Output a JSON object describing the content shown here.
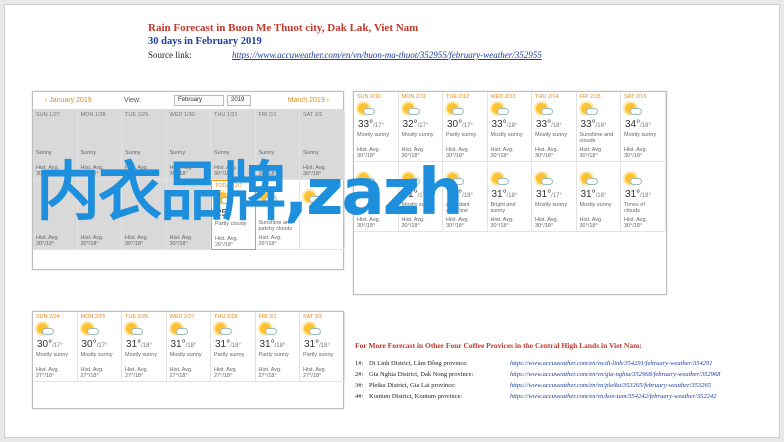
{
  "header": {
    "title": "Rain Forecast in Buon Me Thuot city, Dak Lak, Viet Nam",
    "subtitle": "30 days in February 2019",
    "source_label": "Source link:",
    "source_url": "https://www.accuweather.com/en/vn/buon-ma-thuot/352955/february-weather/352955"
  },
  "calendar": {
    "prev": "‹ January 2019",
    "view_label": "View:",
    "month_select": "February",
    "year_select": "2019",
    "next": "March 2019 ›"
  },
  "panel1": [
    {
      "day": "SUN 1/27",
      "hi": "",
      "desc": "Sunny",
      "avg": "Hist. Avg. 30°/18°",
      "past": true
    },
    {
      "day": "MON 1/28",
      "hi": "",
      "desc": "Sunny",
      "avg": "Hist. Avg. 30°/18°",
      "past": true
    },
    {
      "day": "TUE 1/29",
      "hi": "",
      "desc": "Sunny",
      "avg": "Hist. Avg. 30°/18°",
      "past": true
    },
    {
      "day": "WED 1/30",
      "hi": "",
      "desc": "Sunny",
      "avg": "Hist. Avg. 30°/18°",
      "past": true
    },
    {
      "day": "THU 1/31",
      "hi": "",
      "desc": "Sunny",
      "avg": "Hist. Avg. 30°/18°",
      "past": true
    },
    {
      "day": "FRI 2/1",
      "hi": "",
      "desc": "Sunny",
      "avg": "Hist. Avg. 30°/18°",
      "past": true
    },
    {
      "day": "SAT 2/2",
      "hi": "",
      "desc": "Sunny",
      "avg": "Hist. Avg. 30°/18°",
      "past": true
    },
    {
      "day": "",
      "hi": "",
      "desc": "",
      "avg": "Hist. Avg. 30°/18°",
      "past": true
    },
    {
      "day": "",
      "hi": "",
      "desc": "",
      "avg": "Hist. Avg. 30°/18°",
      "past": true
    },
    {
      "day": "",
      "hi": "",
      "desc": "",
      "avg": "Hist. Avg. 30°/18°",
      "past": true
    },
    {
      "day": "",
      "hi": "",
      "desc": "",
      "avg": "Hist. Avg. 30°/18°",
      "past": true
    },
    {
      "day": "TODAY 2/7",
      "hi": "25°",
      "desc": "Partly cloudy",
      "avg": "Hist. Avg. 26°/18°",
      "past": false,
      "today": true
    },
    {
      "day": "",
      "hi": "",
      "desc": "Sunshine and patchy clouds",
      "avg": "Hist. Avg. 26°/18°",
      "past": false
    },
    {
      "day": "",
      "hi": "",
      "desc": "",
      "avg": "",
      "past": false
    }
  ],
  "panel2": [
    {
      "day": "SUN 2/10",
      "hi": "33°",
      "lo": "/17°",
      "desc": "Mostly sunny",
      "avg": "Hist. Avg. 30°/18°"
    },
    {
      "day": "MON 2/11",
      "hi": "32°",
      "lo": "/17°",
      "desc": "Mostly sunny",
      "avg": "Hist. Avg. 30°/18°"
    },
    {
      "day": "TUE 2/12",
      "hi": "30°",
      "lo": "/17°",
      "desc": "Partly sunny",
      "avg": "Hist. Avg. 30°/18°"
    },
    {
      "day": "WED 2/13",
      "hi": "33°",
      "lo": "/18°",
      "desc": "Mostly sunny",
      "avg": "Hist. Avg. 30°/18°"
    },
    {
      "day": "THU 2/14",
      "hi": "33°",
      "lo": "/18°",
      "desc": "Mostly sunny",
      "avg": "Hist. Avg. 30°/18°"
    },
    {
      "day": "FRI 2/15",
      "hi": "33°",
      "lo": "/18°",
      "desc": "Sunshine and clouds",
      "avg": "Hist. Avg. 30°/18°"
    },
    {
      "day": "SAT 2/16",
      "hi": "34°",
      "lo": "/18°",
      "desc": "Mostly sunny",
      "avg": "Hist. Avg. 30°/18°"
    },
    {
      "day": "",
      "hi": "",
      "lo": "",
      "desc": "",
      "avg": "Hist. Avg. 30°/18°"
    },
    {
      "day": "",
      "hi": "31°",
      "lo": "/17°",
      "desc": "Mostly sunny",
      "avg": "Hist. Avg. 30°/18°"
    },
    {
      "day": "",
      "hi": "31°",
      "lo": "/18°",
      "desc": "Abundant sunshine",
      "avg": "Hist. Avg. 30°/18°"
    },
    {
      "day": "",
      "hi": "31°",
      "lo": "/18°",
      "desc": "Bright and sunny",
      "avg": "Hist. Avg. 30°/18°"
    },
    {
      "day": "",
      "hi": "31°",
      "lo": "/17°",
      "desc": "Mostly sunny",
      "avg": "Hist. Avg. 30°/18°"
    },
    {
      "day": "",
      "hi": "31°",
      "lo": "/18°",
      "desc": "Mostly sunny",
      "avg": "Hist. Avg. 30°/18°"
    },
    {
      "day": "",
      "hi": "31°",
      "lo": "/18°",
      "desc": "Times of clouds",
      "avg": "Hist. Avg. 30°/18°"
    }
  ],
  "panel3": [
    {
      "day": "SUN 2/24",
      "hi": "30°",
      "lo": "/17°",
      "desc": "Mostly sunny",
      "avg": "Hist. Avg. 27°/18°"
    },
    {
      "day": "MON 2/25",
      "hi": "30°",
      "lo": "/17°",
      "desc": "Mostly sunny",
      "avg": "Hist. Avg. 27°/18°"
    },
    {
      "day": "TUE 2/26",
      "hi": "31°",
      "lo": "/18°",
      "desc": "Mostly sunny",
      "avg": "Hist. Avg. 27°/18°"
    },
    {
      "day": "WED 2/27",
      "hi": "31°",
      "lo": "/18°",
      "desc": "Mostly sunny",
      "avg": "Hist. Avg. 27°/18°"
    },
    {
      "day": "THU 2/28",
      "hi": "31°",
      "lo": "/18°",
      "desc": "Partly sunny",
      "avg": "Hist. Avg. 27°/18°"
    },
    {
      "day": "FRI 3/1",
      "hi": "31°",
      "lo": "/18°",
      "desc": "Partly sunny",
      "avg": "Hist. Avg. 27°/18°"
    },
    {
      "day": "SAT 3/2",
      "hi": "31°",
      "lo": "/18°",
      "desc": "Partly sunny",
      "avg": "Hist. Avg. 27°/18°"
    }
  ],
  "more": {
    "title": "For More Forecast in Other Four Coffee Provices in the Central High Lands in Viet Nam:",
    "rows": [
      {
        "n": "1#:",
        "name": "Di Linh District, Lâm Đồng province:",
        "url": "https://www.accuweather.com/en/vn/di-linh/354291/february-weather/354291"
      },
      {
        "n": "2#:",
        "name": "Gia Nghia District, Dak Nong province:",
        "url": "https://www.accuweather.com/en/vn/gia-nghia/352968/february-weather/352968"
      },
      {
        "n": "3#:",
        "name": "Pleiku District, Gia Lai province:",
        "url": "https://www.accuweather.com/en/vn/pleiku/353265/february-weather/353265"
      },
      {
        "n": "4#:",
        "name": "Kontum District, Kontum province:",
        "url": "https://www.accuweather.com/en/vn/kon-tum/354242/february-weather/352242"
      }
    ]
  },
  "watermark": "内衣品牌,zazh"
}
